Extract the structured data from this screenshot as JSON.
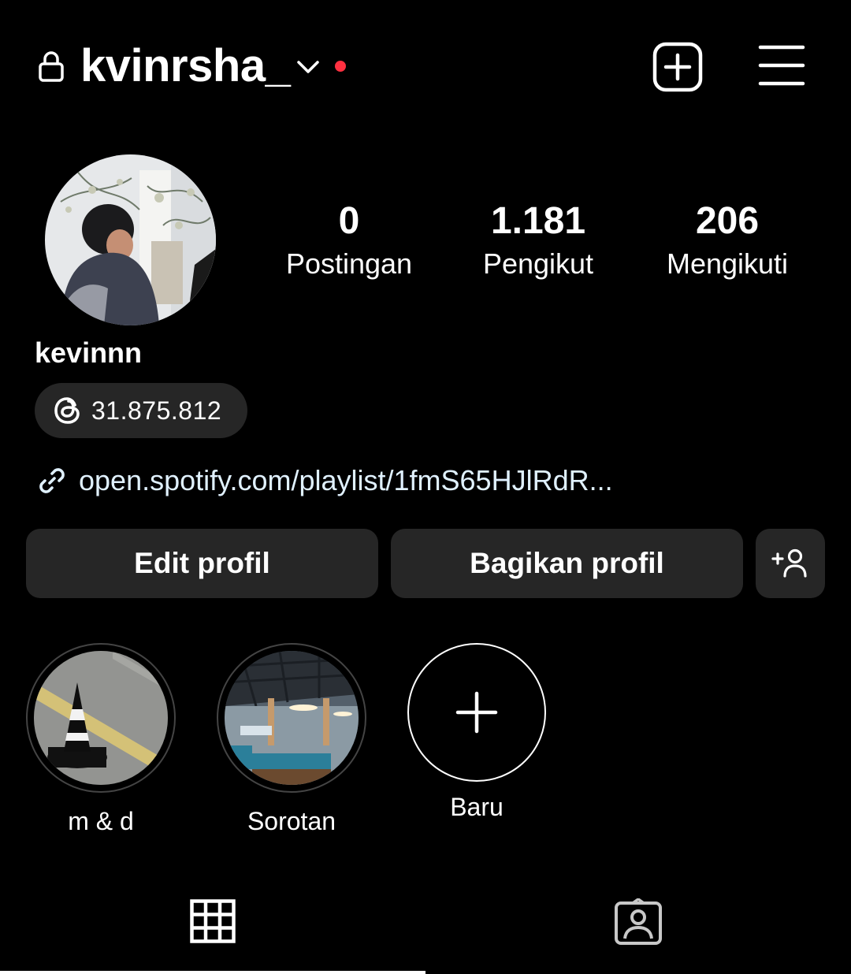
{
  "header": {
    "username": "kvinrsha_",
    "icons": [
      "lock-icon",
      "chevron-down-icon",
      "notification-dot",
      "add-post-icon",
      "menu-icon"
    ]
  },
  "profile": {
    "display_name": "kevinnn",
    "threads_count": "31.875.812",
    "link_text": "open.spotify.com/playlist/1fmS65HJlRdR..."
  },
  "stats": [
    {
      "value": "0",
      "label": "Postingan"
    },
    {
      "value": "1.181",
      "label": "Pengikut"
    },
    {
      "value": "206",
      "label": "Mengikuti"
    }
  ],
  "buttons": {
    "edit": "Edit profil",
    "share": "Bagikan profil"
  },
  "highlights": [
    {
      "label": "m & d"
    },
    {
      "label": "Sorotan"
    },
    {
      "label": "Baru"
    }
  ],
  "colors": {
    "background": "#000000",
    "button": "#262626",
    "notification_dot": "#ff3040"
  }
}
